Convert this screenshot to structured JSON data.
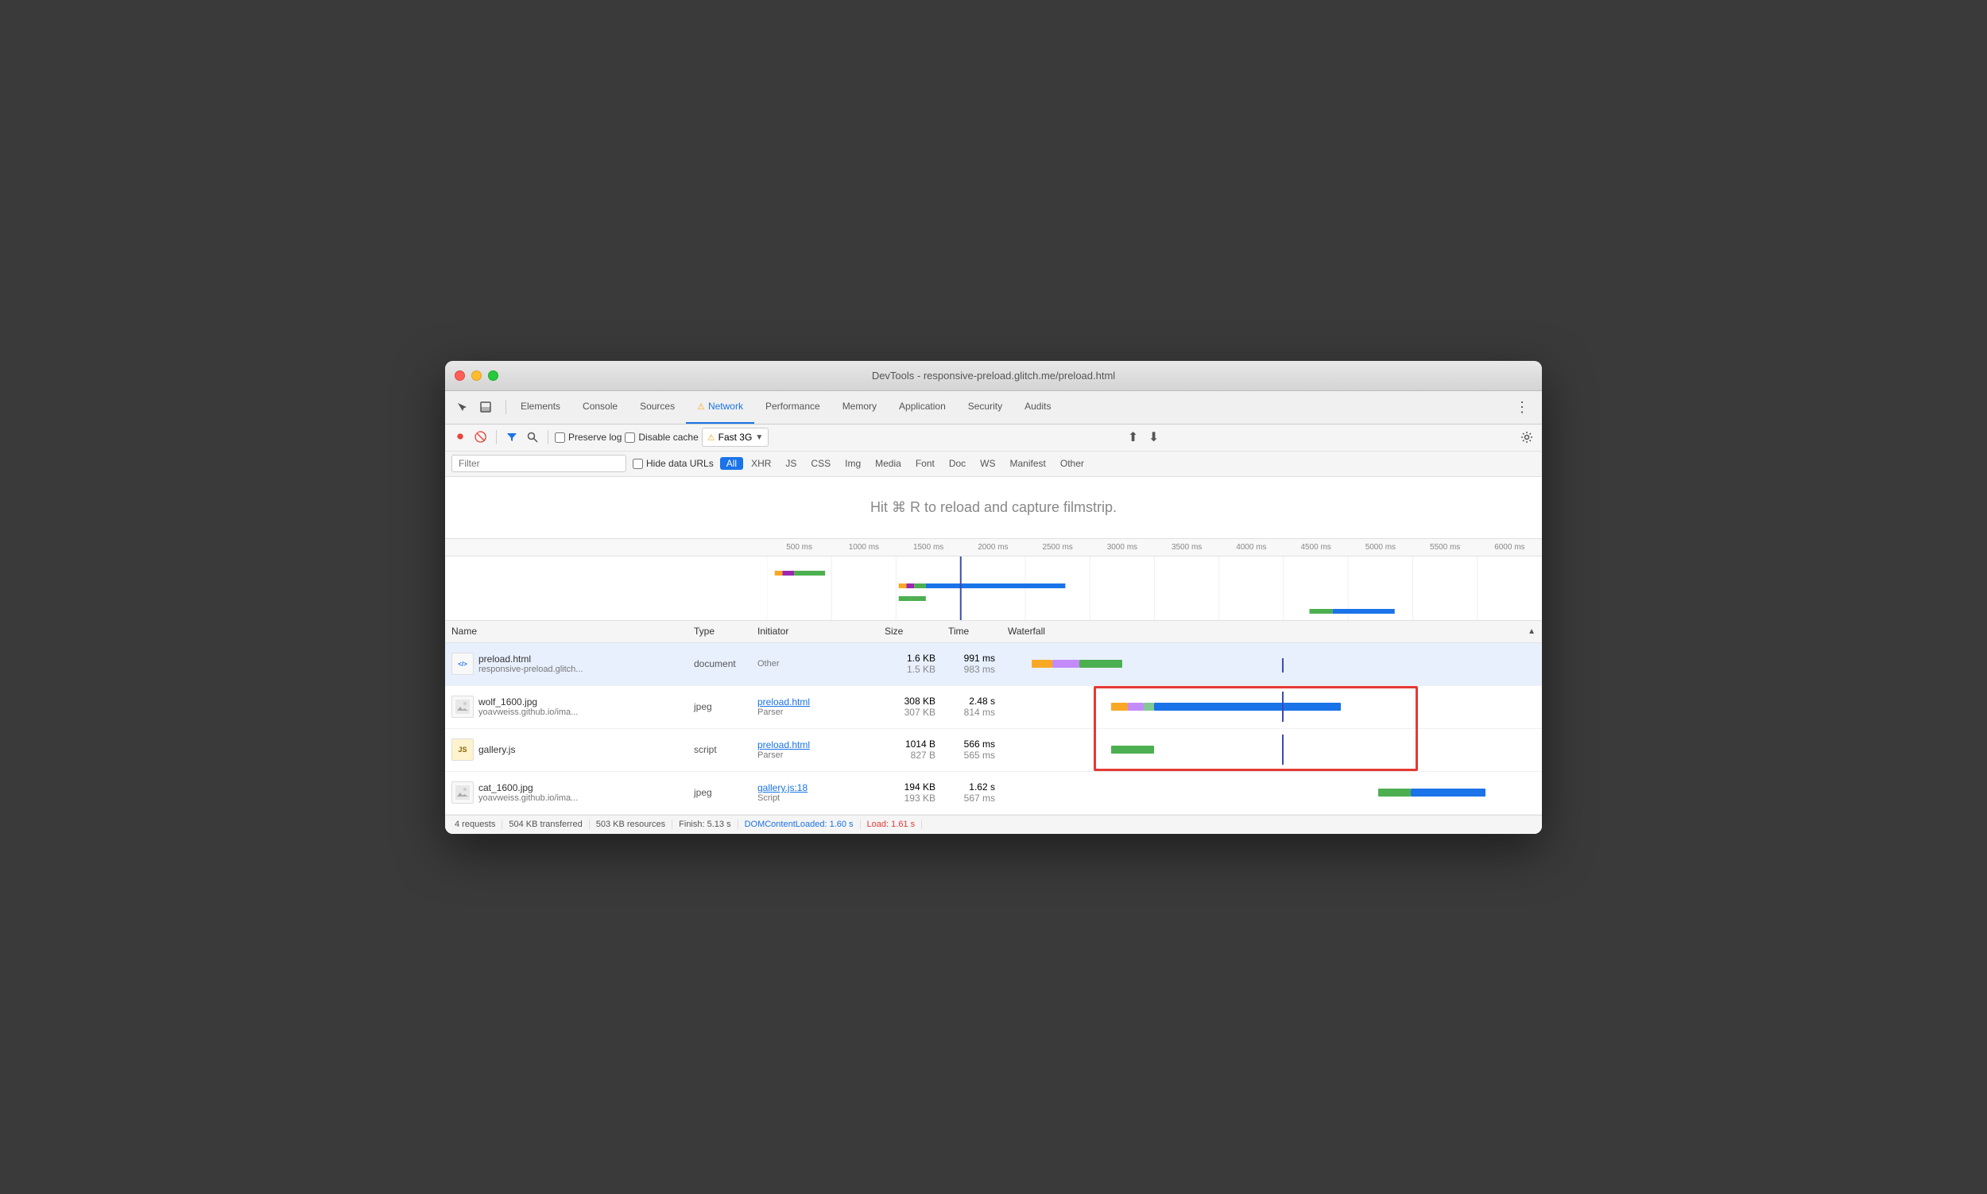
{
  "window": {
    "title": "DevTools - responsive-preload.glitch.me/preload.html"
  },
  "tabs": {
    "items": [
      "Elements",
      "Console",
      "Sources",
      "Network",
      "Performance",
      "Memory",
      "Application",
      "Security",
      "Audits"
    ],
    "active": "Network",
    "warning": "Network"
  },
  "toolbar": {
    "preserve_log_label": "Preserve log",
    "disable_cache_label": "Disable cache",
    "throttle_label": "Fast 3G"
  },
  "filter": {
    "placeholder": "Filter",
    "hide_data_urls_label": "Hide data URLs",
    "types": [
      "All",
      "XHR",
      "JS",
      "CSS",
      "Img",
      "Media",
      "Font",
      "Doc",
      "WS",
      "Manifest",
      "Other"
    ],
    "active_type": "All"
  },
  "filmstrip": {
    "message": "Hit ⌘ R to reload and capture filmstrip."
  },
  "ruler": {
    "marks": [
      "500 ms",
      "1000 ms",
      "1500 ms",
      "2000 ms",
      "2500 ms",
      "3000 ms",
      "3500 ms",
      "4000 ms",
      "4500 ms",
      "5000 ms",
      "5500 ms",
      "6000 ms"
    ]
  },
  "table": {
    "headers": {
      "name": "Name",
      "type": "Type",
      "initiator": "Initiator",
      "size": "Size",
      "time": "Time",
      "waterfall": "Waterfall"
    },
    "rows": [
      {
        "filename": "preload.html",
        "url": "responsive-preload.glitch...",
        "type": "document",
        "initiator_link": "",
        "initiator_text": "Other",
        "size1": "1.6 KB",
        "size2": "1.5 KB",
        "time1": "991 ms",
        "time2": "983 ms",
        "selected": true
      },
      {
        "filename": "wolf_1600.jpg",
        "url": "yoavweiss.github.io/ima...",
        "type": "jpeg",
        "initiator_link": "preload.html",
        "initiator_text": "Parser",
        "size1": "308 KB",
        "size2": "307 KB",
        "time1": "2.48 s",
        "time2": "814 ms",
        "selected": false
      },
      {
        "filename": "gallery.js",
        "url": "",
        "type": "script",
        "initiator_link": "preload.html",
        "initiator_text": "Parser",
        "size1": "1014 B",
        "size2": "827 B",
        "time1": "566 ms",
        "time2": "565 ms",
        "selected": false
      },
      {
        "filename": "cat_1600.jpg",
        "url": "yoavweiss.github.io/ima...",
        "type": "jpeg",
        "initiator_link": "gallery.js:18",
        "initiator_text": "Script",
        "size1": "194 KB",
        "size2": "193 KB",
        "time1": "1.62 s",
        "time2": "567 ms",
        "selected": false
      }
    ]
  },
  "status_bar": {
    "requests": "4 requests",
    "transferred": "504 KB transferred",
    "resources": "503 KB resources",
    "finish": "Finish: 5.13 s",
    "dom_content_loaded": "DOMContentLoaded: 1.60 s",
    "load": "Load: 1.61 s"
  }
}
